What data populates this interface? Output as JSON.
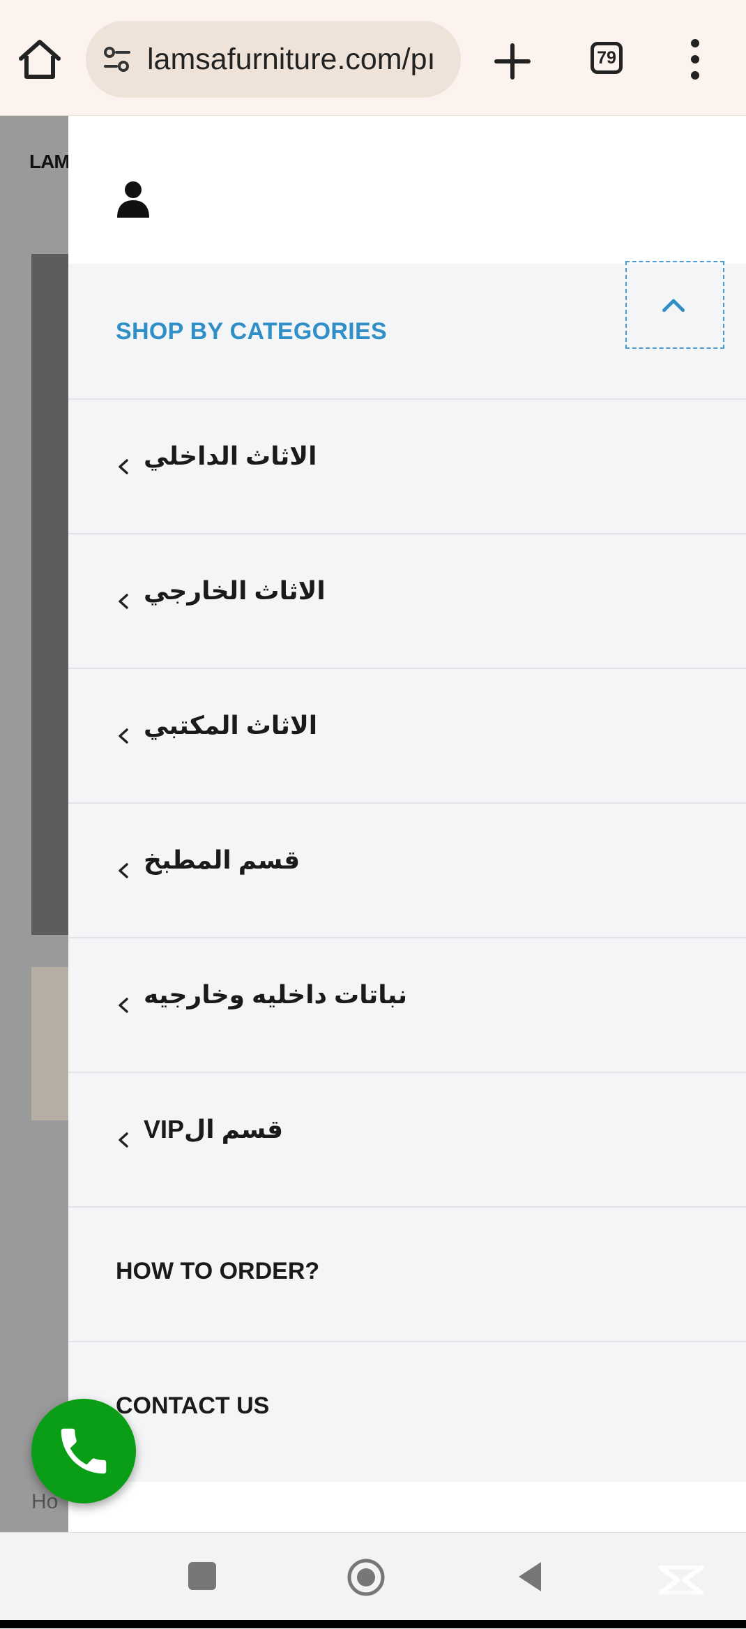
{
  "browser": {
    "url": "lamsafurniture.com/pı",
    "tab_count": "79"
  },
  "page_behind": {
    "logo_fragment": "LAM",
    "text_fragment": "Ho"
  },
  "drawer": {
    "categories_title": "SHOP BY CATEGORIES",
    "items": [
      {
        "label": "الاثاث الداخلي",
        "has_submenu": true
      },
      {
        "label": "الاثاث الخارجي",
        "has_submenu": true
      },
      {
        "label": "الاثاث المكتبي",
        "has_submenu": true
      },
      {
        "label": "قسم المطبخ",
        "has_submenu": true
      },
      {
        "label": "نباتات داخليه وخارجيه",
        "has_submenu": true
      },
      {
        "label": "قسم الVIP",
        "has_submenu": true
      }
    ],
    "links": [
      {
        "label": "HOW TO ORDER?"
      },
      {
        "label": "CONTACT US"
      }
    ]
  },
  "colors": {
    "accent": "#2f8fc6",
    "call_button": "#0a9e16",
    "topbar_bg": "#fcf3ee",
    "url_bg": "#efe2d8"
  },
  "icons": {
    "home": "home-icon",
    "site_settings": "tune-icon",
    "new_tab": "plus-icon",
    "menu": "more-vert-icon",
    "user": "user-icon",
    "collapse": "chevron-up-icon",
    "submenu": "chevron-left-icon",
    "call": "phone-icon"
  }
}
